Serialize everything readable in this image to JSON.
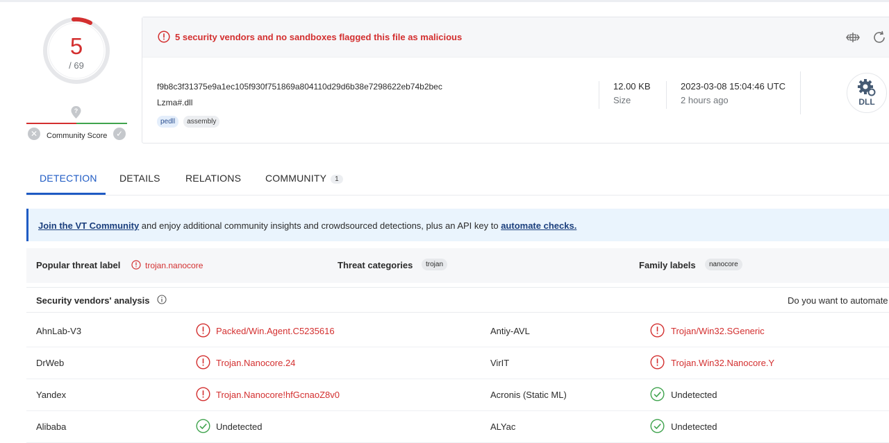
{
  "score": {
    "detections": "5",
    "total": "/ 69"
  },
  "community": {
    "label": "Community Score"
  },
  "summary": {
    "alert": "5 security vendors and no sandboxes flagged this file as malicious",
    "hash": "f9b8c3f31375e9a1ec105f930f751869a804110d29d6b38e7298622eb74b2bec",
    "filename": "Lzma#.dll",
    "tags": [
      "pedll",
      "assembly"
    ],
    "size_value": "12.00 KB",
    "size_label": "Size",
    "date_value": "2023-03-08 15:04:46 UTC",
    "date_relative": "2 hours ago",
    "filetype_badge": "DLL"
  },
  "tabs": {
    "detection": "DETECTION",
    "details": "DETAILS",
    "relations": "RELATIONS",
    "community": "COMMUNITY",
    "community_count": "1"
  },
  "banner": {
    "link1": "Join the VT Community",
    "middle": " and enjoy additional community insights and crowdsourced detections, plus an API key to ",
    "link2": "automate checks."
  },
  "threat": {
    "popular_label": "Popular threat label",
    "popular_value": "trojan.nanocore",
    "categories_label": "Threat categories",
    "categories_value": "trojan",
    "family_label": "Family labels",
    "family_value": "nanocore"
  },
  "analysis": {
    "title": "Security vendors' analysis",
    "right_text": "Do you want to automate",
    "rows": [
      {
        "v1": "AhnLab-V3",
        "r1": "Packed/Win.Agent.C5235616",
        "v2": "Antiy-AVL",
        "r2": "Trojan/Win32.SGeneric"
      },
      {
        "v1": "DrWeb",
        "r1": "Trojan.Nanocore.24",
        "v2": "VirIT",
        "r2": "Trojan.Win32.Nanocore.Y"
      },
      {
        "v1": "Yandex",
        "r1": "Trojan.Nanocore!hfGcnaoZ8v0",
        "v2": "Acronis (Static ML)",
        "r2": "Undetected"
      },
      {
        "v1": "Alibaba",
        "r1": "Undetected",
        "v2": "ALYac",
        "r2": "Undetected"
      }
    ]
  },
  "colors": {
    "malicious": "#d32f2f",
    "clean": "#3fa34d",
    "accent": "#1f5bc4"
  },
  "icons": [
    "alert-circle-icon",
    "compare-icon",
    "refresh-icon",
    "dll-gear-icon",
    "info-icon",
    "check-circle-icon",
    "community-pin-icon",
    "thumbs-down-icon",
    "thumbs-up-icon"
  ]
}
